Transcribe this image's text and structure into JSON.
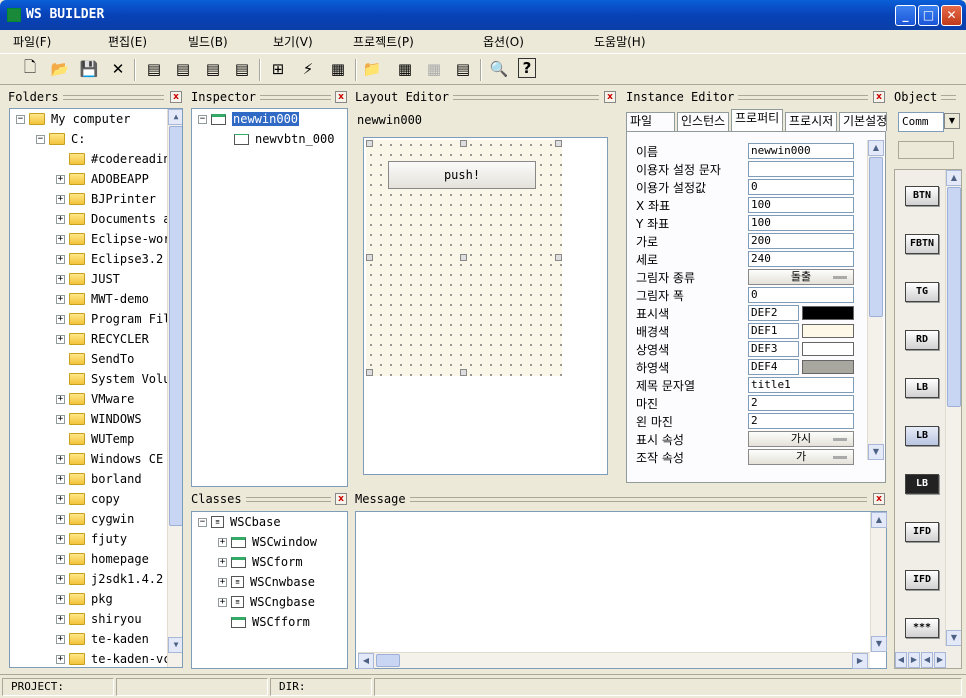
{
  "window": {
    "title": "WS BUILDER",
    "min_label": "_",
    "max_label": "□",
    "close_label": "✕"
  },
  "menus": [
    "파일(F)",
    "편집(E)",
    "빌드(B)",
    "보기(V)",
    "프로젝트(P)",
    "옵션(O)",
    "도움말(H)"
  ],
  "toolbar": {
    "new": "🗋",
    "open": "📂",
    "save": "💾",
    "cut": "✕",
    "t5": "▤",
    "t6": "▤",
    "t7": "▤",
    "t8": "▤",
    "t9": "⊞",
    "t10": "⚡",
    "t11": "▦",
    "t12": "📁",
    "t13": "▦",
    "t14": "▦",
    "t15": "▤",
    "t16": "🔍",
    "help": "?"
  },
  "folders": {
    "title": "Folders",
    "root": "My computer",
    "drive": "C:",
    "items": [
      "#codereading",
      "ADOBEAPP",
      "BJPrinter",
      "Documents and",
      "Eclipse-work",
      "Eclipse3.2",
      "JUST",
      "MWT-demo",
      "Program Files",
      "RECYCLER",
      "SendTo",
      "System Volume",
      "VMware",
      "WINDOWS",
      "WUTemp",
      "Windows CE",
      "borland",
      "copy",
      "cygwin",
      "fjuty",
      "homepage",
      "j2sdk1.4.2",
      "pkg",
      "shiryou",
      "te-kaden",
      "te-kaden-vc"
    ]
  },
  "inspector": {
    "title": "Inspector",
    "items": [
      "newwin000",
      "newvbtn_000"
    ]
  },
  "layout_editor": {
    "title": "Layout Editor",
    "window_name": "newwin000",
    "button_label": "push!"
  },
  "instance_editor": {
    "title": "Instance Editor",
    "tabs": [
      "파일",
      "인스턴스",
      "프로퍼티",
      "프로시저",
      "기본설정"
    ],
    "props": [
      {
        "label": "이름",
        "value": "newwin000",
        "kind": "text"
      },
      {
        "label": "이용자 설정 문자",
        "value": "",
        "kind": "text"
      },
      {
        "label": "이용가 설정값",
        "value": "0",
        "kind": "text"
      },
      {
        "label": "X 좌표",
        "value": "100",
        "kind": "text"
      },
      {
        "label": "Y 좌표",
        "value": "100",
        "kind": "text"
      },
      {
        "label": "가로",
        "value": "200",
        "kind": "text"
      },
      {
        "label": "세로",
        "value": "240",
        "kind": "text"
      },
      {
        "label": "그림자 종류",
        "value": "돌출",
        "kind": "combo"
      },
      {
        "label": "그림자 폭",
        "value": "0",
        "kind": "text"
      },
      {
        "label": "표시색",
        "value": "DEF2",
        "kind": "color",
        "color": "#000000"
      },
      {
        "label": "배경색",
        "value": "DEF1",
        "kind": "color",
        "color": "#fdf8e8"
      },
      {
        "label": "상영색",
        "value": "DEF3",
        "kind": "color",
        "color": "#ffffff"
      },
      {
        "label": "하영색",
        "value": "DEF4",
        "kind": "color",
        "color": "#a8a8a0"
      },
      {
        "label": "제목 문자열",
        "value": "title1",
        "kind": "text"
      },
      {
        "label": "마진",
        "value": "2",
        "kind": "text"
      },
      {
        "label": "왼 마진",
        "value": "2",
        "kind": "text"
      },
      {
        "label": "표시 속성",
        "value": "가시",
        "kind": "combo"
      },
      {
        "label": "조작 속성",
        "value": "가",
        "kind": "combo"
      }
    ]
  },
  "object": {
    "title": "Object",
    "combo_value": "Comm",
    "controls": [
      "BTN",
      "FBTN",
      "TG",
      "RD",
      "LB",
      "LB",
      "LB",
      "IFD",
      "IFD",
      "***"
    ]
  },
  "classes": {
    "title": "Classes",
    "root": "WSCbase",
    "items": [
      "WSCwindow",
      "WSCform",
      "WSCnwbase",
      "WSCngbase",
      "WSCfform"
    ]
  },
  "message": {
    "title": "Message"
  },
  "status": {
    "project": "PROJECT:",
    "dir": "DIR:"
  },
  "colors": {
    "titlebar": "#0842b8",
    "selection": "#316ac5"
  }
}
